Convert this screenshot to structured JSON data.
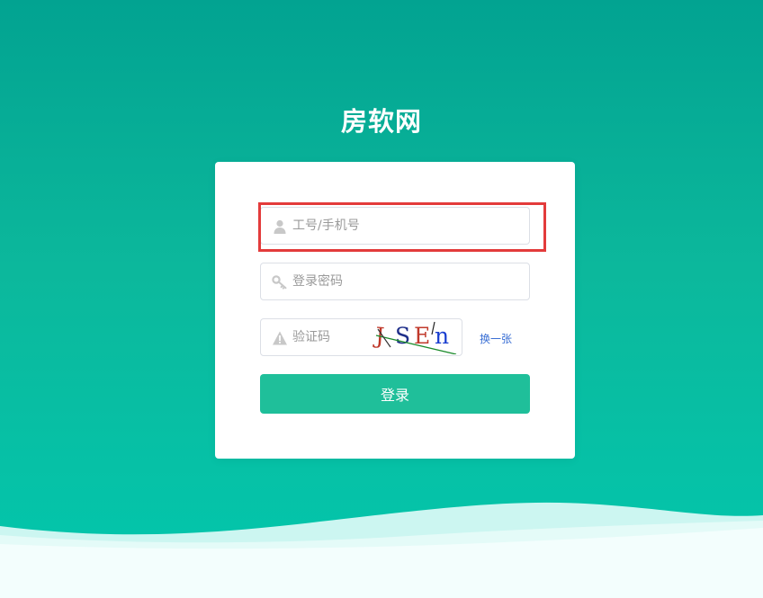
{
  "site": {
    "title": "房软网"
  },
  "form": {
    "username": {
      "value": "",
      "placeholder": "工号/手机号"
    },
    "password": {
      "value": "",
      "placeholder": "登录密码"
    },
    "captcha": {
      "value": "",
      "placeholder": "验证码",
      "image_text": [
        "J",
        "S",
        "E",
        "n"
      ],
      "image_colors": [
        "#c0392b",
        "#1f2f8a",
        "#c0392b",
        "#1a3fd0"
      ],
      "refresh_label": "换一张"
    },
    "submit_label": "登录"
  },
  "colors": {
    "background_top": "#02a391",
    "background_bottom": "#02c7ad",
    "button": "#1fbf9a",
    "highlight": "#e33b3b",
    "link": "#3a6fd4"
  }
}
